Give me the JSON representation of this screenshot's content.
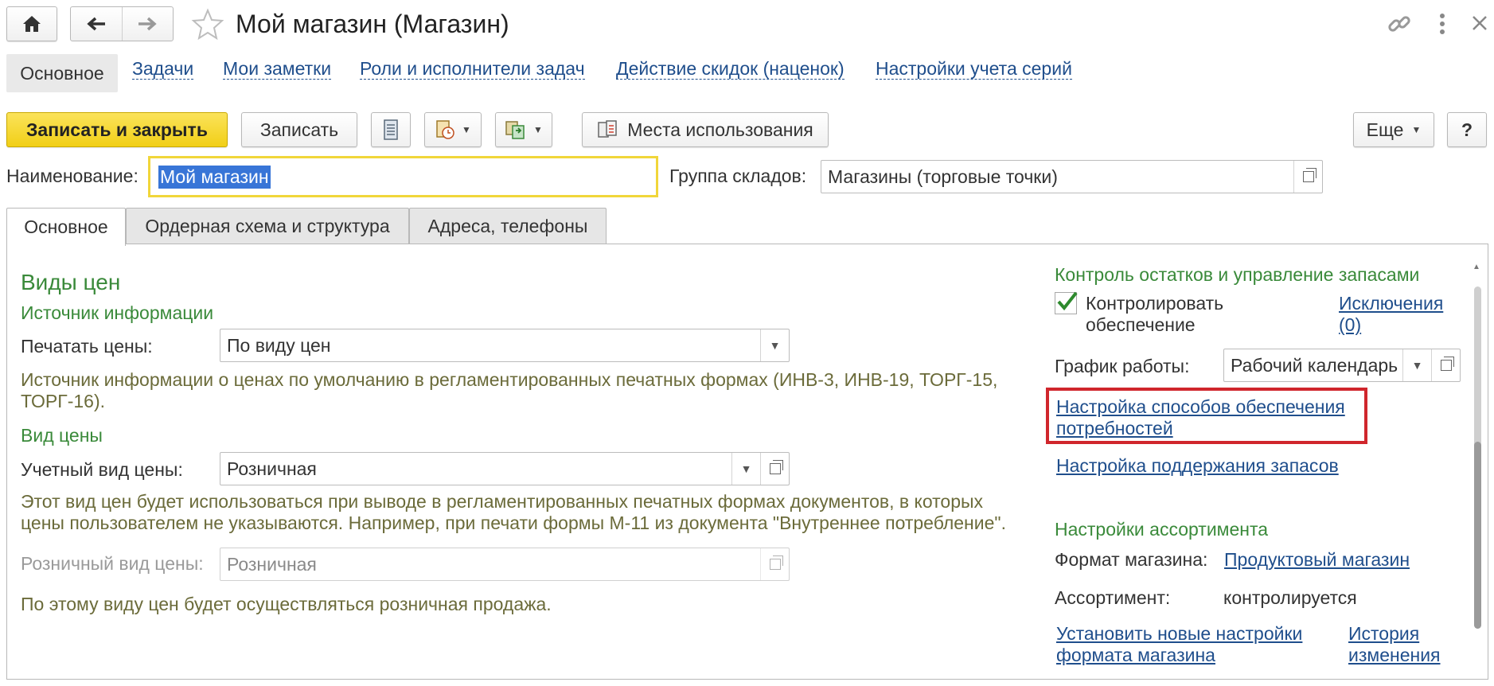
{
  "window": {
    "title": "Мой магазин (Магазин)"
  },
  "nav_tabs": [
    {
      "label": "Основное"
    },
    {
      "label": "Задачи"
    },
    {
      "label": "Мои заметки"
    },
    {
      "label": "Роли и исполнители задач"
    },
    {
      "label": "Действие скидок (наценок)"
    },
    {
      "label": "Настройки учета серий"
    }
  ],
  "toolbar": {
    "save_close": "Записать и закрыть",
    "save": "Записать",
    "usage_places": "Места использования",
    "more": "Еще",
    "help": "?"
  },
  "header_fields": {
    "name_label": "Наименование:",
    "name_value": "Мой магазин",
    "group_label": "Группа складов:",
    "group_value": "Магазины (торговые точки)"
  },
  "form_tabs": [
    {
      "label": "Основное"
    },
    {
      "label": "Ордерная схема и структура"
    },
    {
      "label": "Адреса, телефоны"
    }
  ],
  "left": {
    "section_title": "Виды цен",
    "source_title": "Источник информации",
    "print_prices_label": "Печатать цены:",
    "print_prices_value": "По виду цен",
    "source_hint_1": "Источник информации о ценах по умолчанию в регламентированных печатных формах (ИНВ-3, ИНВ-19, ТОРГ-15,",
    "source_hint_2": "ТОРГ-16).",
    "price_type_title": "Вид цены",
    "account_price_label": "Учетный вид цены:",
    "account_price_value": "Розничная",
    "account_hint_1": "Этот вид цен будет использоваться при выводе в регламентированных печатных формах документов, в которых",
    "account_hint_2": "цены пользователем не указываются. Например, при печати формы М-11 из документа \"Внутреннее потребление\".",
    "retail_price_label": "Розничный вид цены:",
    "retail_price_value": "Розничная",
    "retail_hint": "По этому виду цен будет осуществляться розничная продажа."
  },
  "right": {
    "stock_title": "Контроль остатков и управление запасами",
    "control_line1": "Контролировать",
    "control_line2": "обеспечение",
    "control_checked": true,
    "exceptions_line1": "Исключения",
    "exceptions_line2": "(0)",
    "schedule_label": "График работы:",
    "schedule_value": "Рабочий календарь",
    "supply_link_1": "Настройка способов обеспечения",
    "supply_link_2": "потребностей",
    "stock_support_link": "Настройка поддержания запасов",
    "assortment_title": "Настройки ассортимента",
    "store_format_label": "Формат магазина:",
    "store_format_value": "Продуктовый магазин",
    "assortment_label": "Ассортимент:",
    "assortment_value": "контролируется",
    "new_settings_1": "Установить новые настройки",
    "new_settings_2": "формата магазина",
    "history_1": "История",
    "history_2": "изменения"
  },
  "colors": {
    "accent_yellow": "#f4d41f",
    "section_green": "#3a8a3a",
    "link_blue": "#1f4e8c",
    "highlight_red": "#d0262c",
    "selection_blue": "#3875d7"
  }
}
